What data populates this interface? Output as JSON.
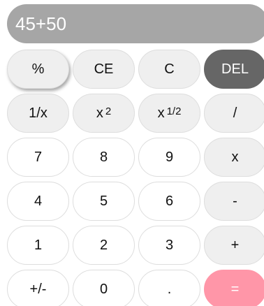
{
  "display": {
    "value": "45+50"
  },
  "keys": [
    {
      "name": "percent-button",
      "label": "%",
      "style": "grey raised"
    },
    {
      "name": "clear-entry-button",
      "label": "CE",
      "style": "grey"
    },
    {
      "name": "clear-button",
      "label": "C",
      "style": "grey"
    },
    {
      "name": "delete-button",
      "label": "DEL",
      "style": "dark"
    },
    {
      "name": "reciprocal-button",
      "label": "1/x",
      "style": "grey"
    },
    {
      "name": "square-button",
      "label": "x",
      "sup": "2",
      "style": "grey"
    },
    {
      "name": "square-root-button",
      "label": "x",
      "sup": "1/2",
      "style": "grey"
    },
    {
      "name": "divide-button",
      "label": "/",
      "style": "grey"
    },
    {
      "name": "digit-7-button",
      "label": "7",
      "style": "white"
    },
    {
      "name": "digit-8-button",
      "label": "8",
      "style": "white"
    },
    {
      "name": "digit-9-button",
      "label": "9",
      "style": "white"
    },
    {
      "name": "multiply-button",
      "label": "x",
      "style": "grey"
    },
    {
      "name": "digit-4-button",
      "label": "4",
      "style": "white"
    },
    {
      "name": "digit-5-button",
      "label": "5",
      "style": "white"
    },
    {
      "name": "digit-6-button",
      "label": "6",
      "style": "white"
    },
    {
      "name": "subtract-button",
      "label": "-",
      "style": "grey"
    },
    {
      "name": "digit-1-button",
      "label": "1",
      "style": "white"
    },
    {
      "name": "digit-2-button",
      "label": "2",
      "style": "white"
    },
    {
      "name": "digit-3-button",
      "label": "3",
      "style": "white"
    },
    {
      "name": "add-button",
      "label": "+",
      "style": "grey"
    },
    {
      "name": "negate-button",
      "label": "+/-",
      "style": "white"
    },
    {
      "name": "digit-0-button",
      "label": "0",
      "style": "white"
    },
    {
      "name": "decimal-button",
      "label": ".",
      "style": "white"
    },
    {
      "name": "equals-button",
      "label": "=",
      "style": "pink"
    }
  ]
}
